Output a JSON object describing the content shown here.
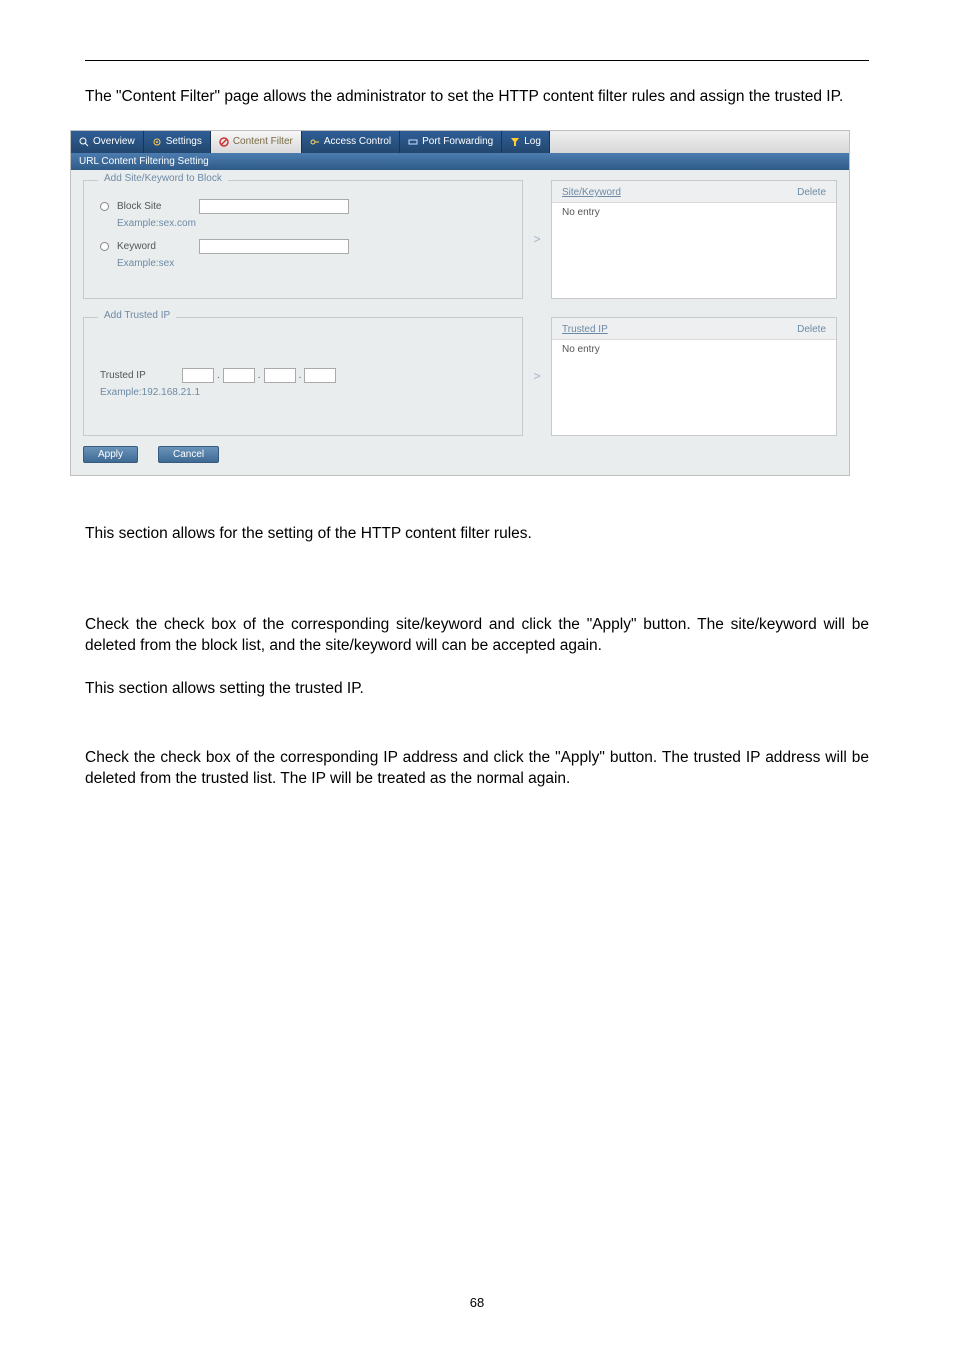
{
  "intro": "The \"Content Filter\" page allows the administrator to set the HTTP content filter rules and assign the trusted IP.",
  "section1": "This section allows for the setting of the HTTP content filter rules.",
  "section2": "Check the check box of the corresponding site/keyword and click the \"Apply\" button. The site/keyword will be deleted from the block list, and the site/keyword will can be accepted again.",
  "section3": "This section allows setting the trusted IP.",
  "section4": "Check the check box of the corresponding IP address and click the \"Apply\" button. The trusted IP address will be deleted from the trusted list. The IP will be treated as the normal again.",
  "page_number": "68",
  "tabs": {
    "overview": "Overview",
    "settings": "Settings",
    "content_filter": "Content Filter",
    "access_control": "Access Control",
    "port_forwarding": "Port Forwarding",
    "log": "Log"
  },
  "subheader": "URL Content Filtering Setting",
  "fieldset1": {
    "legend": "Add Site/Keyword to Block",
    "block_site_label": "Block Site",
    "block_site_hint": "Example:sex.com",
    "keyword_label": "Keyword",
    "keyword_hint": "Example:sex"
  },
  "fieldset2": {
    "legend": "Add Trusted IP",
    "trusted_ip_label": "Trusted IP",
    "trusted_ip_hint": "Example:192.168.21.1"
  },
  "list1": {
    "col1": "Site/Keyword",
    "col2": "Delete",
    "empty": "No entry"
  },
  "list2": {
    "col1": "Trusted IP",
    "col2": "Delete",
    "empty": "No entry"
  },
  "buttons": {
    "apply": "Apply",
    "cancel": "Cancel"
  },
  "arrow": ">"
}
